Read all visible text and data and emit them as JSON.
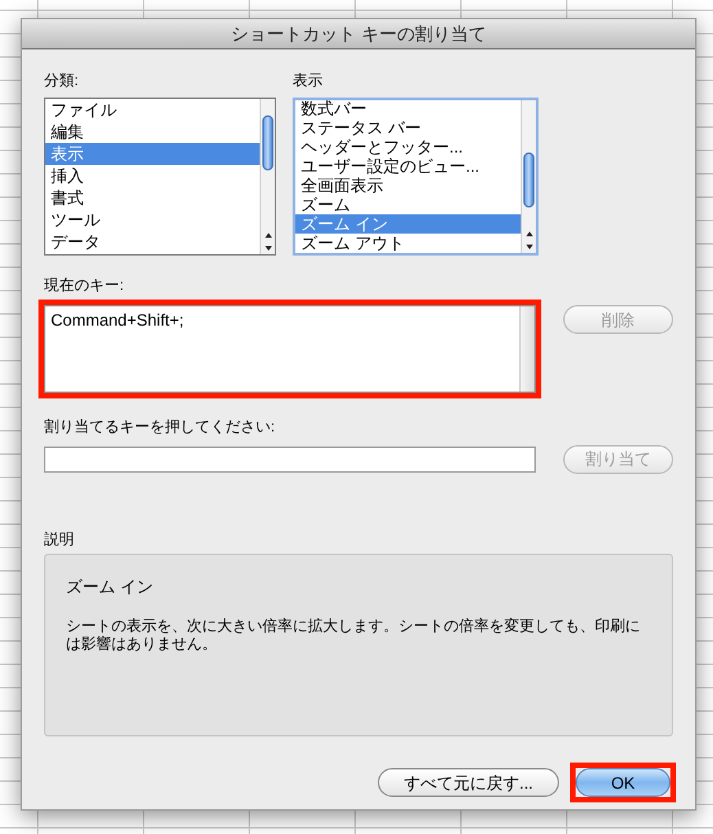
{
  "window": {
    "title": "ショートカット キーの割り当て"
  },
  "categories": {
    "label": "分類:",
    "items": [
      {
        "label": "ファイル",
        "selected": false
      },
      {
        "label": "編集",
        "selected": false
      },
      {
        "label": "表示",
        "selected": true
      },
      {
        "label": "挿入",
        "selected": false
      },
      {
        "label": "書式",
        "selected": false
      },
      {
        "label": "ツール",
        "selected": false
      },
      {
        "label": "データ",
        "selected": false
      }
    ]
  },
  "commands": {
    "label": "表示",
    "items": [
      {
        "label": "数式バー",
        "selected": false
      },
      {
        "label": "ステータス バー",
        "selected": false
      },
      {
        "label": "ヘッダーとフッター...",
        "selected": false
      },
      {
        "label": "ユーザー設定のビュー...",
        "selected": false
      },
      {
        "label": "全画面表示",
        "selected": false
      },
      {
        "label": "ズーム",
        "selected": false
      },
      {
        "label": "ズーム イン",
        "selected": true
      },
      {
        "label": "ズーム アウト",
        "selected": false
      }
    ]
  },
  "current_keys": {
    "label": "現在のキー:",
    "value": "Command+Shift+;",
    "highlighted": true
  },
  "remove_button": {
    "label": "削除",
    "disabled": true
  },
  "new_key": {
    "label": "割り当てるキーを押してください:"
  },
  "assign_button": {
    "label": "割り当て",
    "disabled": true
  },
  "description": {
    "label": "説明",
    "title": "ズーム イン",
    "text": "シートの表示を、次に大きい倍率に拡大します。シートの倍率を変更しても、印刷には影響はありません。"
  },
  "buttons": [
    {
      "label": "すべて元に戻す...",
      "default": false,
      "highlighted": false
    },
    {
      "label": "OK",
      "default": true,
      "highlighted": true
    }
  ]
}
